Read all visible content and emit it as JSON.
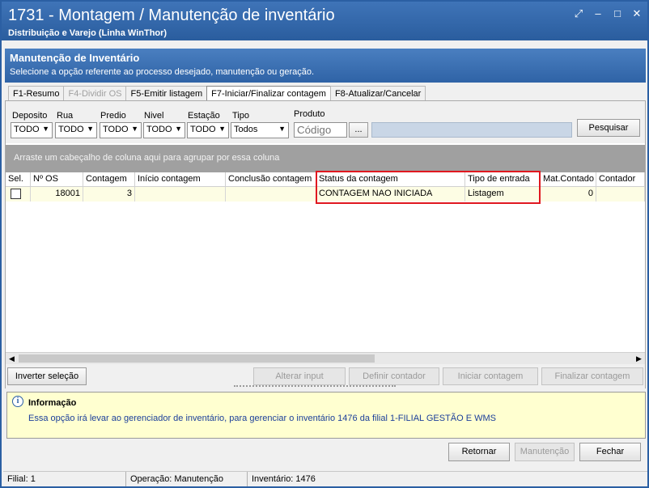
{
  "window": {
    "title": "1731 - Montagem / Manutenção de inventário",
    "subtitle": "Distribuição e Varejo (Linha WinThor)",
    "controls": [
      "restore-icon",
      "minimize-icon",
      "maximize-icon",
      "close-icon"
    ]
  },
  "header": {
    "title": "Manutenção de Inventário",
    "subtitle": "Selecione a opção referente ao processo desejado, manutenção ou geração."
  },
  "tabs": [
    {
      "label": "F1-Resumo",
      "state": "normal"
    },
    {
      "label": "F4-Dividir OS",
      "state": "disabled"
    },
    {
      "label": "F5-Emitir listagem",
      "state": "normal"
    },
    {
      "label": "F7-Iniciar/Finalizar contagem",
      "state": "active"
    },
    {
      "label": "F8-Atualizar/Cancelar",
      "state": "normal"
    }
  ],
  "filters": {
    "deposito": {
      "label": "Deposito",
      "value": "TODO"
    },
    "rua": {
      "label": "Rua",
      "value": "TODO"
    },
    "predio": {
      "label": "Predio",
      "value": "TODO"
    },
    "nivel": {
      "label": "Nivel",
      "value": "TODO"
    },
    "estacao": {
      "label": "Estação",
      "value": "TODO"
    },
    "tipo": {
      "label": "Tipo",
      "value": "Todos"
    },
    "produto": {
      "label": "Produto",
      "placeholder": "Código",
      "lookup": "...",
      "description": ""
    },
    "search_label": "Pesquisar"
  },
  "grid": {
    "group_hint": "Arraste um cabeçalho de coluna aqui para agrupar por essa coluna",
    "columns": [
      "Sel.",
      "Nº OS",
      "Contagem",
      "Início contagem",
      "Conclusão contagem",
      "Status da contagem",
      "Tipo de entrada",
      "Mat.Contado",
      "Contador"
    ],
    "rows": [
      {
        "sel": false,
        "os": "18001",
        "contagem": "3",
        "inicio": "",
        "conclusao": "",
        "status": "CONTAGEM NAO INICIADA",
        "tipo_entrada": "Listagem",
        "mat_contado": "0",
        "contador": ""
      }
    ]
  },
  "actions": {
    "invert": "Inverter seleção",
    "alterar": "Alterar input",
    "definir": "Definir contador",
    "iniciar": "Iniciar contagem",
    "finalizar": "Finalizar contagem"
  },
  "info": {
    "title": "Informação",
    "message": "Essa opção irá levar ao gerenciador de inventário, para gerenciar o inventário 1476 da filial 1-FILIAL GESTÃO E WMS"
  },
  "footer": {
    "retornar": "Retornar",
    "manutencao": "Manutenção",
    "fechar": "Fechar"
  },
  "status_bar": {
    "filial": "Filial: 1",
    "operacao": "Operação: Manutenção",
    "inventario": "Inventário: 1476"
  },
  "colors": {
    "titlebar": "#2a5d9e",
    "highlight_box": "#e01820",
    "row_bg": "#fdfde4",
    "info_bg": "#ffffd0",
    "info_text": "#1c3f9a"
  }
}
